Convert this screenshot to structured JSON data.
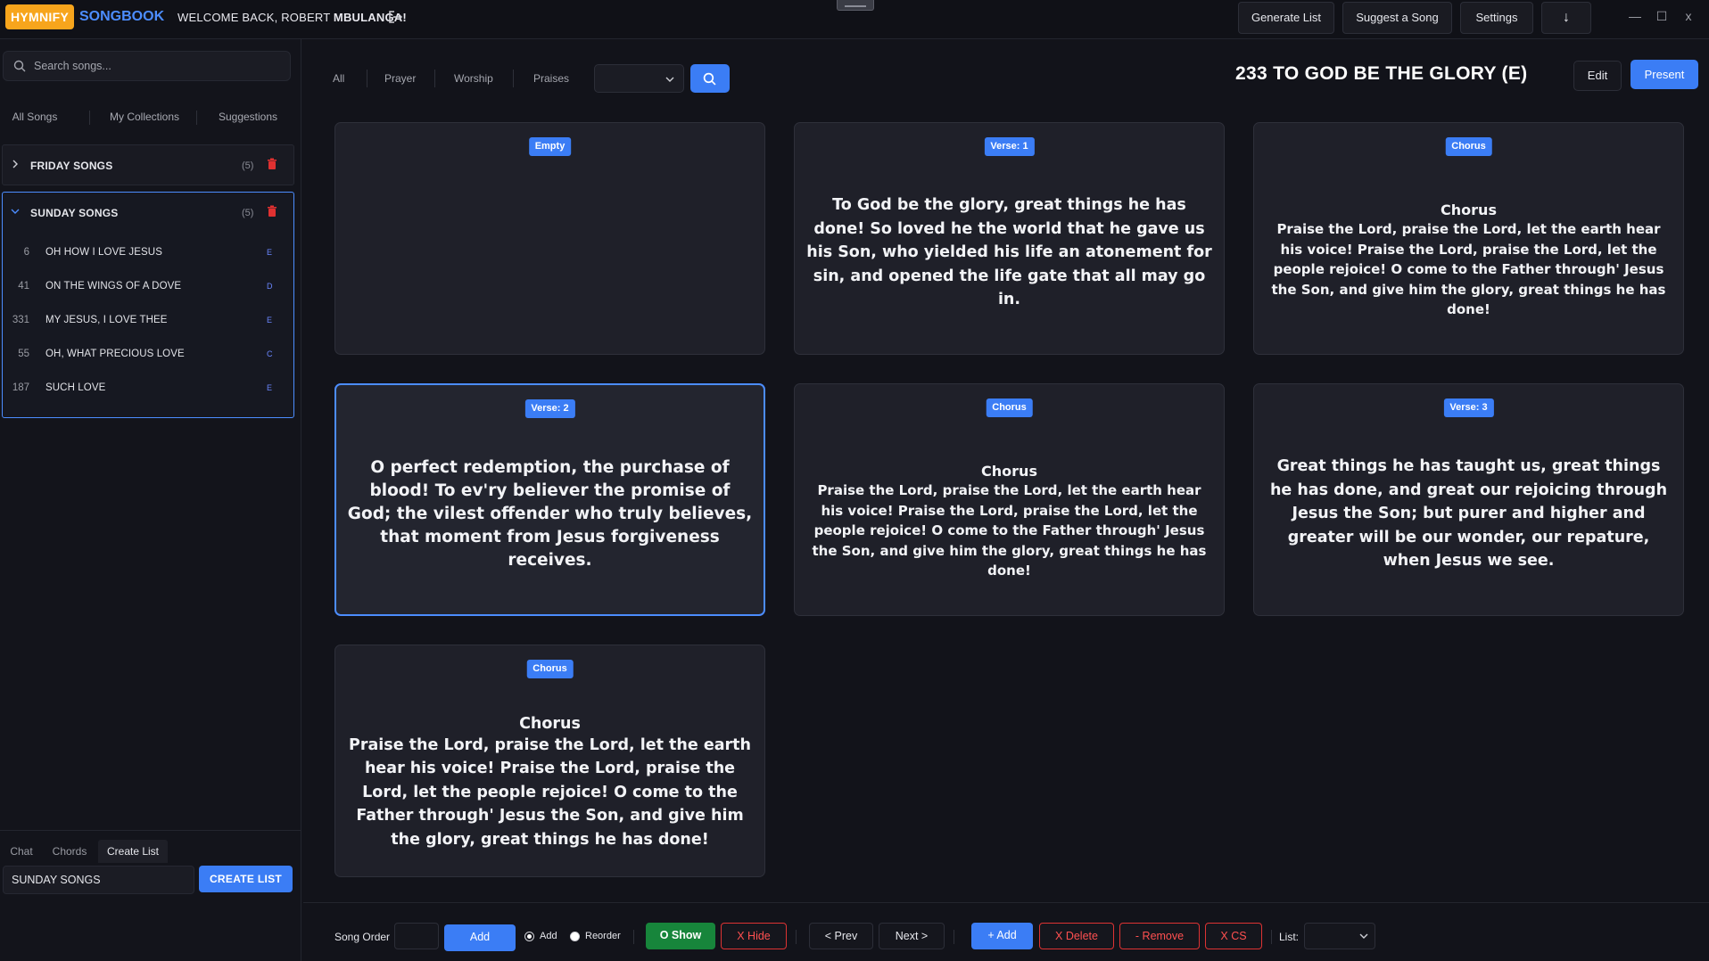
{
  "header": {
    "brand": "HYMNIFY",
    "brand_sub": "SONGBOOK",
    "welcome_prefix": "WELCOME BACK, ROBERT ",
    "welcome_name": "MBULANGA!",
    "buttons": {
      "generate_list": "Generate List",
      "suggest_song": "Suggest a Song",
      "settings": "Settings",
      "download": "↓"
    },
    "window": {
      "minimize": "—",
      "maximize": "☐",
      "close": "x"
    }
  },
  "sidebar": {
    "search_placeholder": "Search songs...",
    "tabs": [
      "All Songs",
      "My Collections",
      "Suggestions"
    ],
    "groups": [
      {
        "name": "FRIDAY SONGS",
        "count": "(5)",
        "expanded": false,
        "songs": []
      },
      {
        "name": "SUNDAY SONGS",
        "count": "(5)",
        "expanded": true,
        "songs": [
          {
            "number": "6",
            "title": "OH HOW I LOVE JESUS",
            "key": "E"
          },
          {
            "number": "41",
            "title": "ON THE WINGS OF A DOVE",
            "key": "D"
          },
          {
            "number": "331",
            "title": "MY JESUS, I LOVE THEE",
            "key": "E"
          },
          {
            "number": "55",
            "title": "OH, WHAT PRECIOUS LOVE",
            "key": "C"
          },
          {
            "number": "187",
            "title": "SUCH LOVE",
            "key": "E"
          }
        ]
      }
    ],
    "bottom_tabs": [
      "Chat",
      "Chords",
      "Create List"
    ],
    "list_name_value": "SUNDAY SONGS",
    "create_list_label": "CREATE LIST"
  },
  "filters": {
    "tabs": [
      "All",
      "Prayer",
      "Worship",
      "Praises"
    ],
    "select_value": ""
  },
  "song": {
    "title": "233 TO GOD BE THE GLORY (E)",
    "edit_label": "Edit",
    "present_label": "Present",
    "slides": [
      {
        "badge": "Empty",
        "heading": "",
        "text": ""
      },
      {
        "badge": "Verse: 1",
        "heading": "",
        "text": "To God be the glory, great things he has done! So loved he the world that he gave us his Son, who yielded his life an atonement for sin, and opened the life gate that all may go in."
      },
      {
        "badge": "Chorus",
        "heading": "Chorus",
        "text": "Praise the Lord, praise the Lord, let the earth hear his voice! Praise the Lord, praise the Lord, let the people rejoice! O come to the Father through' Jesus the Son, and give him the glory, great things he has done!"
      },
      {
        "badge": "Verse: 2",
        "heading": "",
        "text": "O perfect redemption, the purchase of blood! To ev'ry believer the promise of God; the vilest offender who truly believes, that moment from Jesus forgiveness receives."
      },
      {
        "badge": "Chorus",
        "heading": "Chorus",
        "text": "Praise the Lord, praise the Lord, let the earth hear his voice! Praise the Lord, praise the Lord, let the people rejoice! O come to the Father through' Jesus the Son, and give him the glory, great things he has done!"
      },
      {
        "badge": "Verse: 3",
        "heading": "",
        "text": "Great things he has taught us, great things he has done, and great our rejoicing through Jesus the Son; but purer and higher and greater will be our wonder, our repature, when Jesus we see."
      },
      {
        "badge": "Chorus",
        "heading": "Chorus",
        "text": "Praise the Lord, praise the Lord, let the earth hear his voice! Praise the Lord, praise the Lord, let the people rejoice! O come to the Father through' Jesus the Son, and give him the glory, great things he has done!"
      }
    ]
  },
  "bottombar": {
    "song_order_label": "Song Order",
    "song_order_value": "",
    "add_label": "Add",
    "radio_add": "Add",
    "radio_reorder": "Reorder",
    "show_label": "O Show",
    "hide_label": "X Hide",
    "prev_label": "< Prev",
    "next_label": "Next >",
    "plus_add_label": "+ Add",
    "delete_label": "X Delete",
    "remove_label": "- Remove",
    "cs_label": "X CS",
    "list_label": "List:",
    "list_value": ""
  },
  "colors": {
    "accent": "#3b7df5",
    "brand": "#f7a51c",
    "danger": "#ff5050",
    "success": "#17853b"
  }
}
